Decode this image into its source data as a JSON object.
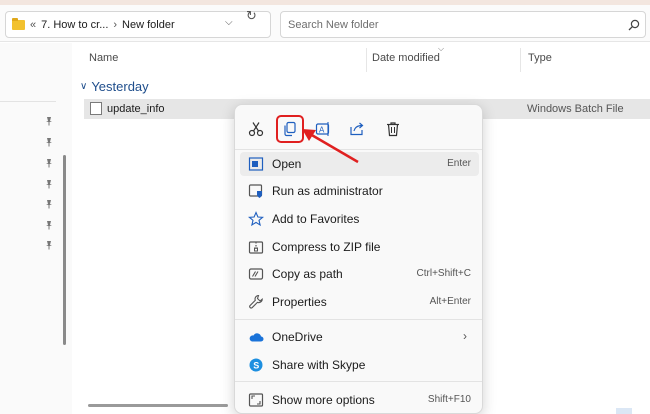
{
  "address_bar": {
    "overflow": "«",
    "crumbs": [
      "7. How to cr...",
      "New folder"
    ],
    "separator": "›"
  },
  "search": {
    "placeholder": "Search New folder"
  },
  "columns": {
    "name": "Name",
    "date_modified": "Date modified",
    "type": "Type"
  },
  "group": {
    "label": "Yesterday"
  },
  "file": {
    "name": "update_info",
    "type": "Windows Batch File"
  },
  "context_menu": {
    "quick_actions": [
      {
        "name": "cut-icon"
      },
      {
        "name": "copy-icon",
        "highlighted": true
      },
      {
        "name": "rename-icon"
      },
      {
        "name": "share-icon"
      },
      {
        "name": "delete-icon"
      }
    ],
    "items": [
      {
        "label": "Open",
        "shortcut": "Enter",
        "icon": "open-icon"
      },
      {
        "label": "Run as administrator",
        "shortcut": "",
        "icon": "admin-shield-icon"
      },
      {
        "label": "Add to Favorites",
        "shortcut": "",
        "icon": "star-icon"
      },
      {
        "label": "Compress to ZIP file",
        "shortcut": "",
        "icon": "zip-icon"
      },
      {
        "label": "Copy as path",
        "shortcut": "Ctrl+Shift+C",
        "icon": "copy-path-icon"
      },
      {
        "label": "Properties",
        "shortcut": "Alt+Enter",
        "icon": "wrench-icon"
      },
      {
        "label": "OneDrive",
        "shortcut": "",
        "icon": "onedrive-icon"
      },
      {
        "label": "Share with Skype",
        "shortcut": "",
        "icon": "skype-icon"
      },
      {
        "label": "Show more options",
        "shortcut": "Shift+F10",
        "icon": "more-options-icon"
      }
    ]
  },
  "colors": {
    "accent": "#1f5fbf",
    "highlight": "#e02020",
    "group_label": "#1f4e8c"
  }
}
